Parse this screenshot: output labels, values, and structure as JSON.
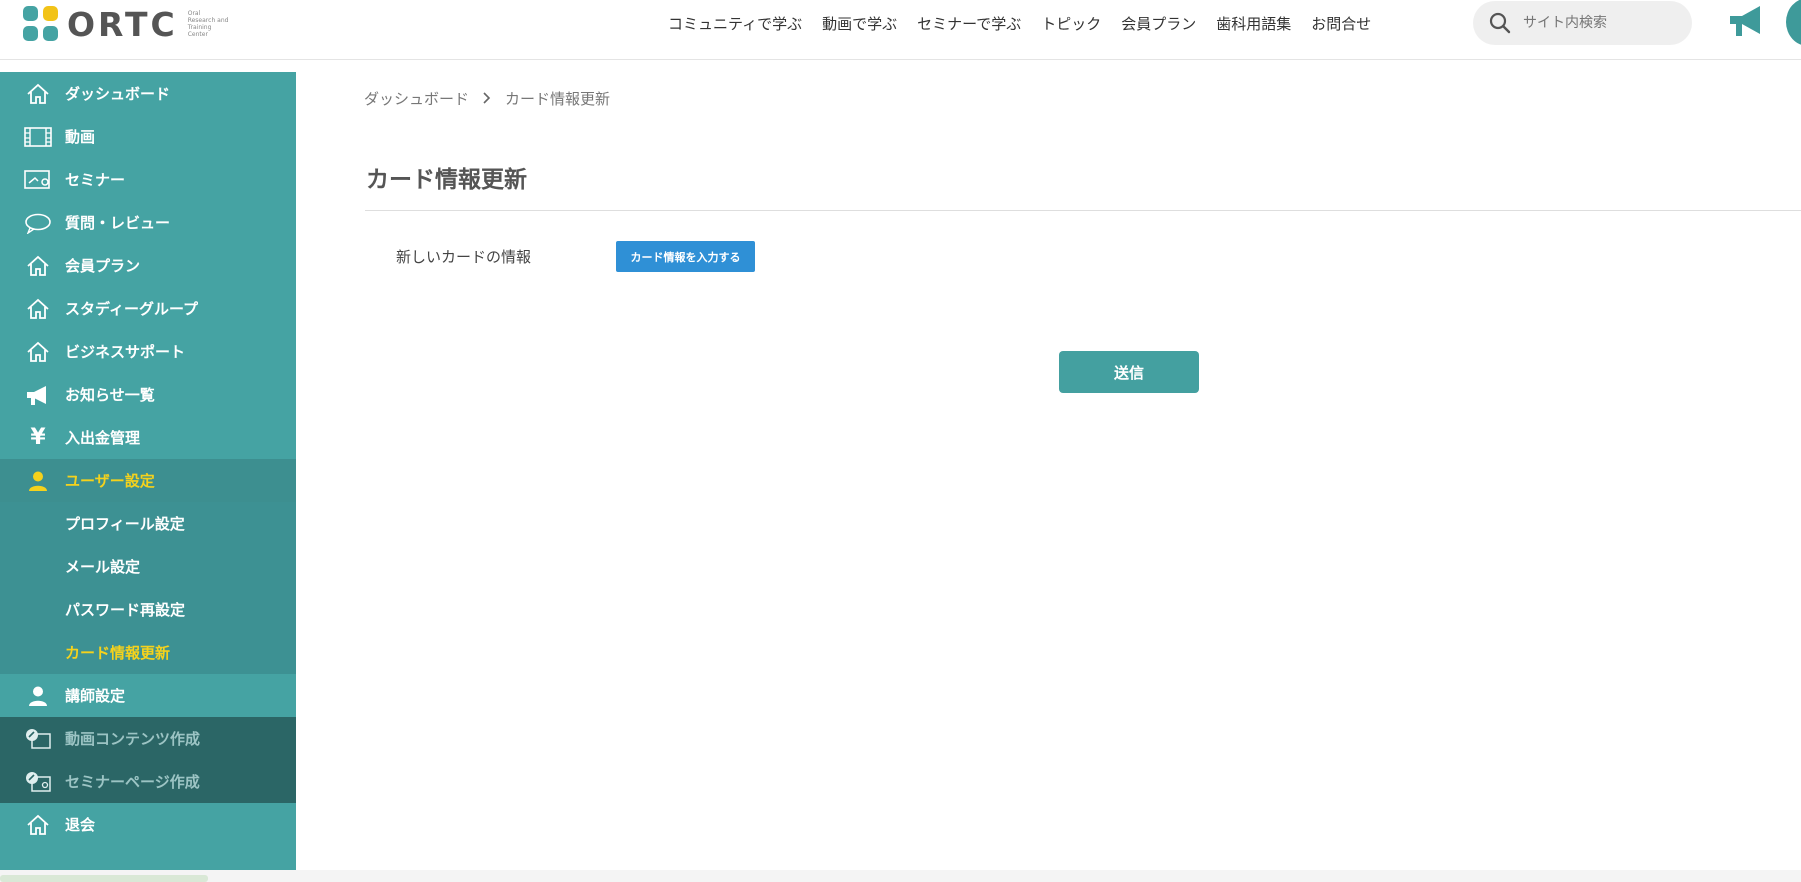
{
  "brand": {
    "name": "ORTC",
    "tagline_lines": [
      "Oral",
      "Research and",
      "Training",
      "Center"
    ],
    "colors": {
      "teal": "#45a3a3",
      "yellow": "#f2c318",
      "accent_text": "#f5d21c",
      "button_blue": "#2f90d6"
    }
  },
  "topnav": [
    {
      "label": "コミュニティで学ぶ"
    },
    {
      "label": "動画で学ぶ"
    },
    {
      "label": "セミナーで学ぶ"
    },
    {
      "label": "トピック"
    },
    {
      "label": "会員プラン"
    },
    {
      "label": "歯科用語集"
    },
    {
      "label": "お問合せ"
    }
  ],
  "search": {
    "placeholder": "サイト内検索",
    "icon": "search-icon"
  },
  "header_icons": [
    "megaphone-icon",
    "user-avatar"
  ],
  "sidebar": {
    "items": [
      {
        "label": "ダッシュボード",
        "icon": "home-icon"
      },
      {
        "label": "動画",
        "icon": "film-icon"
      },
      {
        "label": "セミナー",
        "icon": "seminar-icon"
      },
      {
        "label": "質問・レビュー",
        "icon": "chat-bubble-icon"
      },
      {
        "label": "会員プラン",
        "icon": "home-icon"
      },
      {
        "label": "スタディーグループ",
        "icon": "home-icon"
      },
      {
        "label": "ビジネスサポート",
        "icon": "home-icon"
      },
      {
        "label": "お知らせ一覧",
        "icon": "megaphone-icon"
      },
      {
        "label": "入出金管理",
        "icon": "yen-icon"
      },
      {
        "label": "ユーザー設定",
        "icon": "user-icon",
        "active": true
      }
    ],
    "user_settings_sub": [
      {
        "label": "プロフィール設定"
      },
      {
        "label": "メール設定"
      },
      {
        "label": "パスワード再設定"
      },
      {
        "label": "カード情報更新",
        "current": true
      }
    ],
    "instructor": {
      "label": "講師設定",
      "icon": "user-icon"
    },
    "disabled_items": [
      {
        "label": "動画コンテンツ作成",
        "icon": "video-edit-icon"
      },
      {
        "label": "セミナーページ作成",
        "icon": "seminar-edit-icon"
      }
    ],
    "withdraw": {
      "label": "退会",
      "icon": "home-icon"
    }
  },
  "breadcrumb": [
    "ダッシュボード",
    "カード情報更新"
  ],
  "page": {
    "title": "カード情報更新",
    "field_label": "新しいカードの情報",
    "card_button": "カード情報を入力する",
    "submit": "送信"
  }
}
